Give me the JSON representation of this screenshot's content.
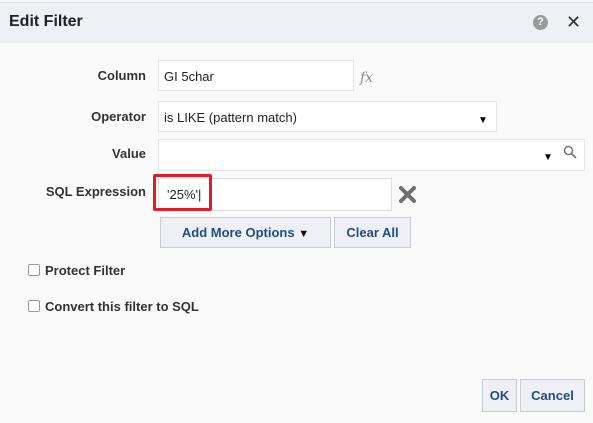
{
  "dialog": {
    "title": "Edit Filter",
    "help_icon": "question-circle-icon",
    "help_glyph": "?",
    "close_icon": "close-icon",
    "close_glyph": "✕"
  },
  "form": {
    "column_label": "Column",
    "column_value": "GI 5char",
    "fx_label": "fx",
    "operator_label": "Operator",
    "operator_value": "is LIKE (pattern match)",
    "value_label": "Value",
    "value_value": "",
    "sql_label": "SQL Expression",
    "sql_value": "'25%'|",
    "add_more_options": "Add More Options",
    "clear_all": "Clear All"
  },
  "options": {
    "protect_filter": "Protect Filter",
    "convert_to_sql": "Convert this filter to SQL"
  },
  "footer": {
    "ok": "OK",
    "cancel": "Cancel"
  },
  "colors": {
    "accent_text": "#1f4e85",
    "highlight_border": "#e01c24",
    "title_bar": "#eef0f3"
  }
}
